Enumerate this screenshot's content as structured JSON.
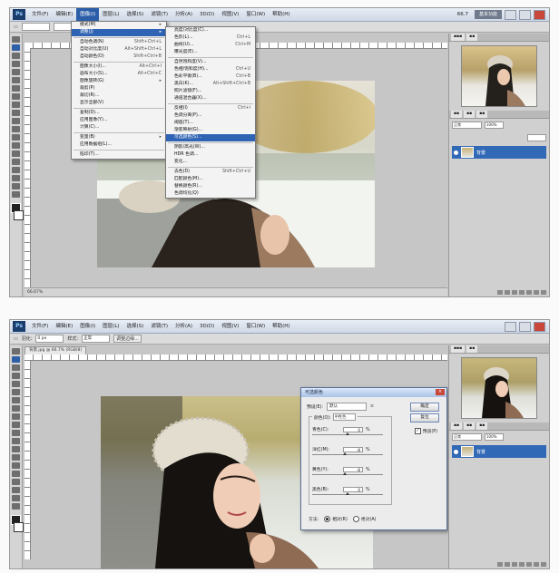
{
  "top_screenshot": {
    "menubar": {
      "items": [
        "文件(F)",
        "编辑(E)",
        "图像(I)",
        "图层(L)",
        "选择(S)",
        "滤镜(T)",
        "分析(A)",
        "3D(D)",
        "视图(V)",
        "窗口(W)",
        "帮助(H)"
      ],
      "active_index": 2,
      "zoom": "66.7",
      "workspace": "基本功能"
    },
    "image_menu": {
      "items": [
        {
          "label": "模式(M)",
          "shortcut": "▸"
        },
        {
          "label": "调整(J)",
          "shortcut": "▸",
          "highlight": true
        },
        {
          "sep": true
        },
        {
          "label": "自动色调(N)",
          "shortcut": "Shift+Ctrl+L"
        },
        {
          "label": "自动对比度(U)",
          "shortcut": "Alt+Shift+Ctrl+L"
        },
        {
          "label": "自动颜色(O)",
          "shortcut": "Shift+Ctrl+B"
        },
        {
          "sep": true
        },
        {
          "label": "图像大小(I)...",
          "shortcut": "Alt+Ctrl+I"
        },
        {
          "label": "画布大小(S)...",
          "shortcut": "Alt+Ctrl+C"
        },
        {
          "label": "图像旋转(G)",
          "shortcut": "▸"
        },
        {
          "label": "裁剪(P)",
          "shortcut": ""
        },
        {
          "label": "裁切(R)...",
          "shortcut": ""
        },
        {
          "label": "显示全部(V)",
          "shortcut": ""
        },
        {
          "sep": true
        },
        {
          "label": "复制(D)...",
          "shortcut": ""
        },
        {
          "label": "应用图像(Y)...",
          "shortcut": ""
        },
        {
          "label": "计算(C)...",
          "shortcut": ""
        },
        {
          "sep": true
        },
        {
          "label": "变量(B)",
          "shortcut": "▸"
        },
        {
          "label": "应用数据组(L)...",
          "shortcut": ""
        },
        {
          "sep": true
        },
        {
          "label": "陷印(T)...",
          "shortcut": ""
        }
      ]
    },
    "adjust_menu": {
      "items": [
        {
          "label": "亮度/对比度(C)...",
          "shortcut": ""
        },
        {
          "label": "色阶(L)...",
          "shortcut": "Ctrl+L"
        },
        {
          "label": "曲线(U)...",
          "shortcut": "Ctrl+M"
        },
        {
          "label": "曝光度(E)...",
          "shortcut": ""
        },
        {
          "sep": true
        },
        {
          "label": "自然饱和度(V)...",
          "shortcut": ""
        },
        {
          "label": "色相/饱和度(H)...",
          "shortcut": "Ctrl+U"
        },
        {
          "label": "色彩平衡(B)...",
          "shortcut": "Ctrl+B"
        },
        {
          "label": "黑白(K)...",
          "shortcut": "Alt+Shift+Ctrl+B"
        },
        {
          "label": "照片滤镜(F)...",
          "shortcut": ""
        },
        {
          "label": "通道混合器(X)...",
          "shortcut": ""
        },
        {
          "sep": true
        },
        {
          "label": "反相(I)",
          "shortcut": "Ctrl+I"
        },
        {
          "label": "色调分离(P)...",
          "shortcut": ""
        },
        {
          "label": "阈值(T)...",
          "shortcut": ""
        },
        {
          "label": "渐变映射(G)...",
          "shortcut": ""
        },
        {
          "label": "可选颜色(S)...",
          "shortcut": "",
          "highlight": true
        },
        {
          "sep": true
        },
        {
          "label": "阴影/高光(W)...",
          "shortcut": ""
        },
        {
          "label": "HDR 色调...",
          "shortcut": ""
        },
        {
          "label": "变化...",
          "shortcut": ""
        },
        {
          "sep": true
        },
        {
          "label": "去色(D)",
          "shortcut": "Shift+Ctrl+U"
        },
        {
          "label": "匹配颜色(M)...",
          "shortcut": ""
        },
        {
          "label": "替换颜色(R)...",
          "shortcut": ""
        },
        {
          "label": "色调均化(Q)",
          "shortcut": ""
        }
      ]
    },
    "status": "66.67%",
    "layers": {
      "blend": "正常",
      "opacity": "100%",
      "layer_name": "背景"
    }
  },
  "bottom_screenshot": {
    "menubar": {
      "items": [
        "文件(F)",
        "编辑(E)",
        "图像(I)",
        "图层(L)",
        "选择(S)",
        "滤镜(T)",
        "分析(A)",
        "3D(D)",
        "视图(V)",
        "窗口(W)",
        "帮助(H)"
      ]
    },
    "options": {
      "feather_label": "羽化:",
      "feather_value": "0 px",
      "style_label": "样式:",
      "style_value": "正常",
      "refine": "调整边缘..."
    },
    "doc_tab": "背景.jpg @ 66.7% (RGB/8)",
    "dialog": {
      "title": "可选颜色",
      "preset_label": "预设(E):",
      "preset_value": "默认",
      "ok": "确定",
      "cancel": "复位",
      "preview": "预览(P)",
      "colors_label": "颜色(O):",
      "colors_value": "中性色",
      "sliders": [
        {
          "label": "青色(C):",
          "value": "0",
          "pct": "%",
          "fraction": 0.5
        },
        {
          "label": "洋红(M):",
          "value": "-8",
          "pct": "%",
          "fraction": 0.46
        },
        {
          "label": "黄色(Y):",
          "value": "-8",
          "pct": "%",
          "fraction": 0.46
        },
        {
          "label": "黑色(B):",
          "value": "0",
          "pct": "%",
          "fraction": 0.5
        }
      ],
      "method_label": "方法:",
      "method_relative": "相对(R)",
      "method_absolute": "绝对(A)"
    },
    "layers": {
      "blend": "正常",
      "opacity": "100%",
      "layer_name": "背景"
    }
  },
  "colors": {
    "highlight": "#2f63b3",
    "layer_selected": "#3269b6"
  }
}
